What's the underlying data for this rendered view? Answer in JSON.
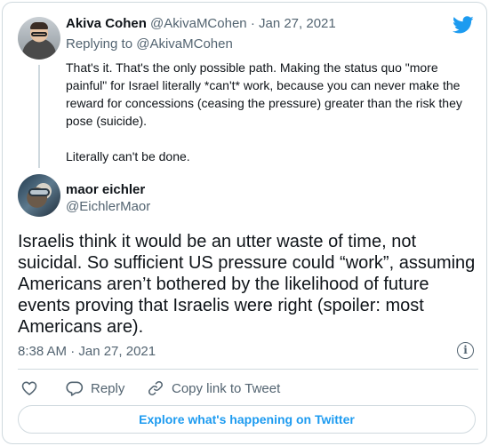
{
  "parent_tweet": {
    "name": "Akiva Cohen",
    "handle": "@AkivaMCohen",
    "separator": "·",
    "date": "Jan 27, 2021",
    "replying_prefix": "Replying to",
    "replying_to": "@AkivaMCohen",
    "paragraphs": [
      "That's it. That's the only possible path. Making the status quo \"more painful\" for Israel literally *can't* work, because you can never make the reward for concessions (ceasing the pressure) greater than the risk they pose (suicide).",
      "Literally can't be done."
    ]
  },
  "tweet": {
    "name": "maor eichler",
    "handle": "@EichlerMaor",
    "text": "Israelis think it would be an utter waste of time, not suicidal. So sufficient US pressure could “work”, assuming Americans aren’t bothered by the likelihood of future events proving that Israelis were right (spoiler: most Americans are).",
    "timestamp": "8:38 AM · Jan 27, 2021"
  },
  "actions": {
    "like_icon": "heart-icon",
    "reply_icon": "speech-bubble-icon",
    "reply_label": "Reply",
    "copy_icon": "link-icon",
    "copy_label": "Copy link to Tweet",
    "info_icon": "info-icon"
  },
  "explore_label": "Explore what's happening on Twitter",
  "colors": {
    "brand": "#1d9bf0",
    "text": "#0f1419",
    "secondary": "#536471",
    "border": "#cfd9de"
  }
}
